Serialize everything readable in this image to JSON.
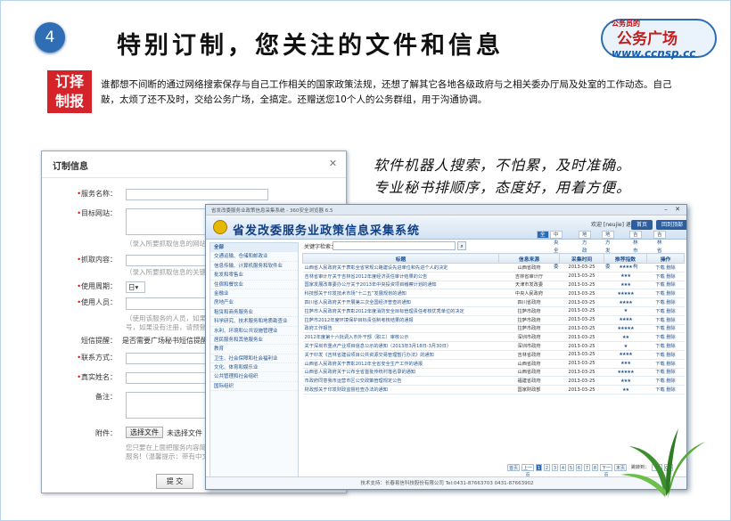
{
  "slide": {
    "number": "4",
    "title": "特别订制，您关注的文件和信息",
    "logo": {
      "top": "公务员的",
      "main": "公务广场",
      "url": "www.ccnsp.cc"
    },
    "stamp": [
      "订择",
      "制报"
    ],
    "intro": "谁都想不间断的通过网络搜索保存与自己工作相关的国家政策法规，还想了解其它各地各级政府与之相关委办厅局及处室的工作动态。自己敲，太烦了还不及时，交给公务广场，全搞定。还赠送您10个人的公务群组，用于沟通协调。",
    "handwriting": [
      "软件机器人搜索，不怕累，及时准确。",
      "专业秘书排顺序，态度好，用着方便。"
    ]
  },
  "dialog": {
    "title": "订制信息",
    "fields": {
      "service_name": "服务名称：",
      "target_site": "目标网站：",
      "target_hint": "（录入所要抓取信息的网站地址",
      "fetch_content": "抓取内容：",
      "content_hint": "（录入所要抓取信息的关键字）",
      "period": "使用周期：",
      "period_value": "日",
      "users": "使用人员：",
      "users_hint1": "（使用该服务的人员，如果这些",
      "users_hint2": "号，如果没有注册，请预登录",
      "sms": "短信提醒：",
      "sms_text": "是否需要广场秘书短信提醒服",
      "contact": "联系方式：",
      "real_name": "真实姓名：",
      "remark": "备注：",
      "attachment": "附件：",
      "choose_file": "选择文件",
      "no_file": "未选择文件",
      "attach_hint1": "您只要在上面把服务内容简要说",
      "attach_hint2": "服务!（温馨提示：带有中文名",
      "submit": "提 交"
    }
  },
  "app": {
    "window_title": "省发改委服务业政策信息采集系统 - 360安全浏览器 6.5",
    "title": "省发改委服务业政策信息采集系统",
    "user": "欢迎 [neujie] 退出",
    "header_buttons": [
      "首页",
      "回到顶部"
    ],
    "tabs": [
      "全部",
      "中央全部委",
      "地方政府",
      "地方发改委",
      "吉林市机构",
      "吉林省"
    ],
    "sidebar": [
      "全部",
      "交通运输、仓储和邮政业",
      "信息传输、计算机服务和软件业",
      "批发和零售业",
      "住宿和餐饮业",
      "金融业",
      "房地产业",
      "租赁和商务服务业",
      "科学研究、技术服务和地质勘查业",
      "水利、环境和公共设施管理业",
      "居民服务和其他服务业",
      "教育",
      "卫生、社会保障和社会福利业",
      "文化、体育和娱乐业",
      "公共管理和社会组织",
      "国际组织"
    ],
    "keyword_label": "关键字检索：",
    "columns": [
      "标题",
      "信息来源",
      "采集时间",
      "推荐指数",
      "操作"
    ],
    "rows": [
      {
        "title": "山西省人民政府关于表彰全省常规公路建设先进单位和先进个人的决定",
        "source": "山西省政府",
        "date": "2013-03-25",
        "stars": "★★★★",
        "ops": "下载 删除"
      },
      {
        "title": "吉林省审计厅关于吉林省2012年度经济责任审计结果的公告",
        "source": "吉林省审计厅",
        "date": "2013-03-25",
        "stars": "★★★",
        "ops": "下载 删除"
      },
      {
        "title": "国家发展改革委办公厅关于2013年中央投资项目稽察计划的通知",
        "source": "天津市发改委",
        "date": "2013-03-25",
        "stars": "★★★",
        "ops": "下载 删除"
      },
      {
        "title": "科技部关于印发技术市场“十二五”发展规划的通知",
        "source": "中央人民政府",
        "date": "2013-03-25",
        "stars": "★★★★★",
        "ops": "下载 删除"
      },
      {
        "title": "四川省人民政府关于开展第三次全国经济普查的通知",
        "source": "四川省政府",
        "date": "2013-03-25",
        "stars": "★★★★",
        "ops": "下载 删除"
      },
      {
        "title": "拉萨市人民政府关于表彰2012年度消防安全目标管理责任考核优秀单位的决定",
        "source": "拉萨市政府",
        "date": "2013-03-25",
        "stars": "★",
        "ops": "下载 删除"
      },
      {
        "title": "拉萨市2012年度环境保护目标责任制考核结果的通报",
        "source": "拉萨市政府",
        "date": "2013-03-25",
        "stars": "★★★★",
        "ops": "下载 删除"
      },
      {
        "title": "政府工作报告",
        "source": "拉萨市政府",
        "date": "2013-03-25",
        "stars": "★★★★★",
        "ops": "下载 删除"
      },
      {
        "title": "2012年度第十六批调入市外干部（职工）审核公示",
        "source": "深圳市政府",
        "date": "2013-03-25",
        "stars": "★★",
        "ops": "下载 删除"
      },
      {
        "title": "关于深圳市重点产业项目信息公示的通知（2013年3月18日-3月30日）",
        "source": "深圳市政府",
        "date": "2013-03-25",
        "stars": "★",
        "ops": "下载 删除"
      },
      {
        "title": "关于印发《吉林省建设项目公共资源交易管理暂行办法》的通知",
        "source": "吉林省政府",
        "date": "2013-03-25",
        "stars": "★★★★",
        "ops": "下载 删除"
      },
      {
        "title": "山西省人民政府关于表彰2012年全省安全生产工作的通报",
        "source": "山西省政府",
        "date": "2013-03-25",
        "stars": "★★★",
        "ops": "下载 删除"
      },
      {
        "title": "山西省人民政府关于公布全省首批传统村落名录的通知",
        "source": "山西省政府",
        "date": "2013-03-25",
        "stars": "★★★★★",
        "ops": "下载 删除"
      },
      {
        "title": "市政府同意我市运营市区公交政策管理规定公告",
        "source": "福建省政府",
        "date": "2013-03-25",
        "stars": "★★★",
        "ops": "下载 删除"
      },
      {
        "title": "财政部关于印发财政监督检查办法的通知",
        "source": "国家财政部",
        "date": "2013-03-25",
        "stars": "★★",
        "ops": "下载 删除"
      }
    ],
    "pager": [
      "首页",
      "上一页",
      "1",
      "2",
      "3",
      "4",
      "5",
      "6",
      "7",
      "8",
      "下一页",
      "末页"
    ],
    "pager_jump": "跳转到：",
    "pager_go": "GO",
    "footer": "技术支持：长春易信科技股份有限公司 Tel:0431-87663703 0431-87663902"
  }
}
